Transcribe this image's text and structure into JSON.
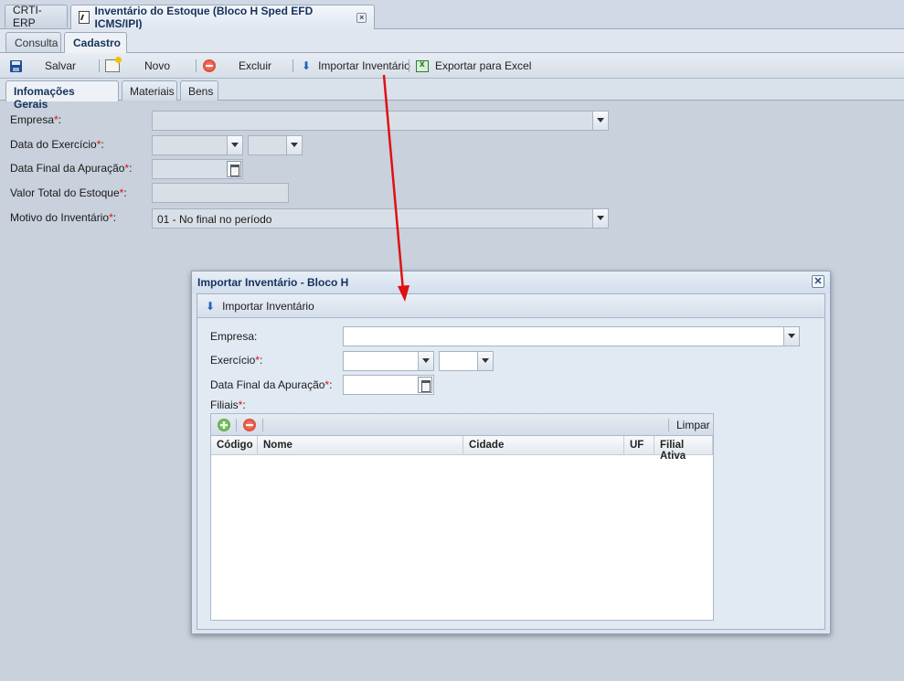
{
  "window_tabs": [
    {
      "label": "CRTI-ERP"
    },
    {
      "label": "Inventário do Estoque (Bloco H Sped EFD ICMS/IPI)"
    }
  ],
  "sub_tabs": [
    {
      "label": "Consulta"
    },
    {
      "label": "Cadastro"
    }
  ],
  "toolbar": {
    "save_label": "Salvar",
    "new_label": "Novo",
    "delete_label": "Excluir",
    "import_label": "Importar Inventário",
    "export_label": "Exportar para Excel"
  },
  "form_tabs": [
    {
      "label": "Infomações Gerais"
    },
    {
      "label": "Materiais"
    },
    {
      "label": "Bens"
    }
  ],
  "form": {
    "empresa_label": "Empresa",
    "data_exercicio_label": "Data do Exercício",
    "data_final_label": "Data Final da Apuração",
    "valor_total_label": "Valor Total do Estoque",
    "motivo_label": "Motivo do Inventário",
    "motivo_value": "01 - No final no período",
    "required_mark": "*",
    "colon": ":"
  },
  "modal": {
    "title": "Importar Inventário - Bloco H",
    "close_symbol": "✕",
    "import_button_label": "Importar Inventário",
    "empresa_label": "Empresa:",
    "exercicio_label": "Exercício",
    "data_final_label": "Data Final da Apuração",
    "filiais_label": "Filiais",
    "limpar_label": "Limpar",
    "grid_columns": [
      "Código",
      "Nome",
      "Cidade",
      "UF",
      "Filial Ativa"
    ]
  },
  "colors": {
    "background": "#c9d1dc",
    "title_text": "#15325c",
    "required": "#dd1111",
    "annotation_arrow": "#e01010"
  },
  "icons": [
    "doc-icon",
    "tab-close-icon",
    "save-icon",
    "new-icon",
    "delete-icon",
    "arrow-down-icon",
    "excel-icon",
    "combo-arrow-icon",
    "calendar-icon",
    "close-icon",
    "add-icon",
    "remove-icon"
  ]
}
